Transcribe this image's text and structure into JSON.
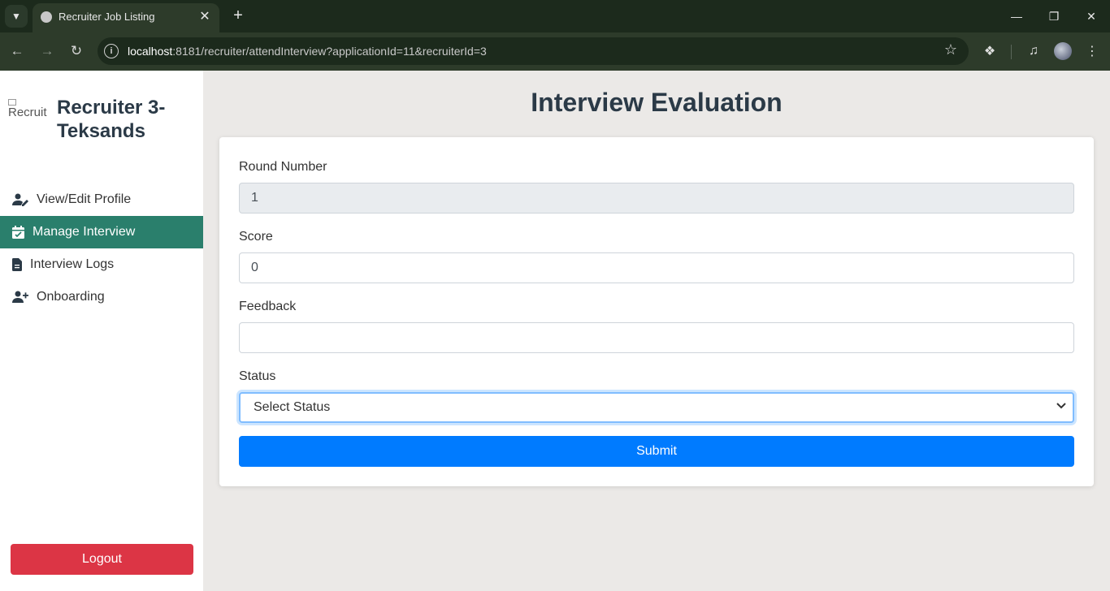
{
  "browser": {
    "tab_title": "Recruiter Job Listing",
    "url_host": "localhost",
    "url_rest": ":8181/recruiter/attendInterview?applicationId=11&recruiterId=3"
  },
  "sidebar": {
    "logo_alt": "Recruit",
    "brand": "Recruiter 3-Teksands",
    "items": [
      {
        "label": "View/Edit Profile",
        "icon": "user-edit-icon"
      },
      {
        "label": "Manage Interview",
        "icon": "calendar-check-icon"
      },
      {
        "label": "Interview Logs",
        "icon": "file-icon"
      },
      {
        "label": "Onboarding",
        "icon": "user-plus-icon"
      }
    ],
    "active_item": "Manage Interview",
    "logout_label": "Logout"
  },
  "main": {
    "title": "Interview Evaluation",
    "form": {
      "round_label": "Round Number",
      "round_value": "1",
      "score_label": "Score",
      "score_value": "0",
      "feedback_label": "Feedback",
      "feedback_value": "",
      "status_label": "Status",
      "status_value": "Select Status",
      "submit_label": "Submit"
    }
  },
  "colors": {
    "active_nav": "#2a7f6c",
    "submit": "#007bff",
    "logout": "#dc3545"
  }
}
